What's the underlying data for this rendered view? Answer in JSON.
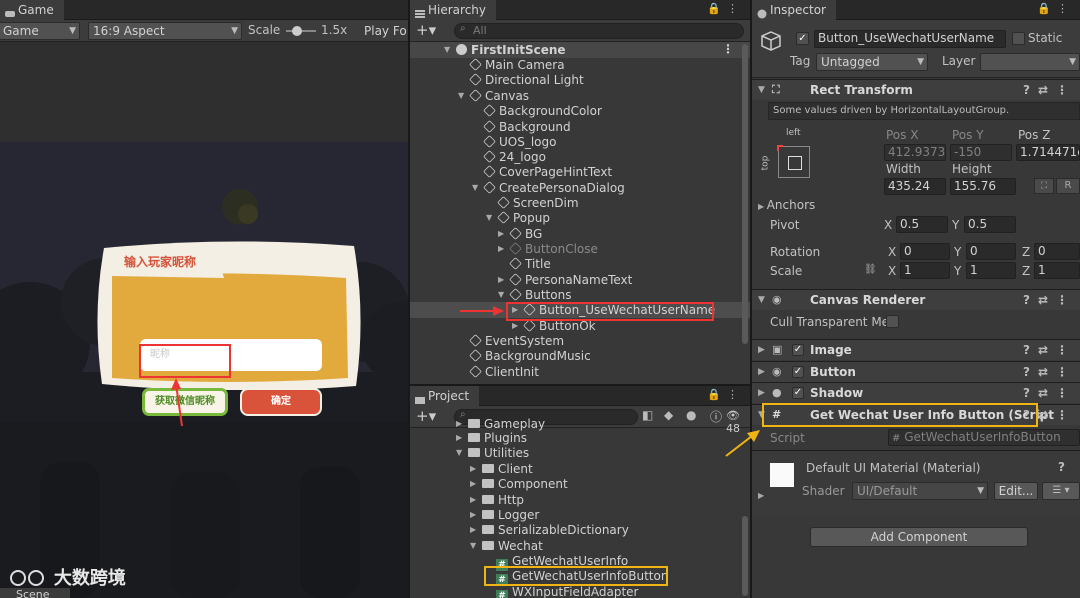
{
  "game": {
    "tab_label": "Game",
    "display_label": "Game",
    "aspect_label": "16:9 Aspect",
    "scale_label": "Scale",
    "scale_value": "1.5x",
    "play_label": "Play Fo",
    "dialog": {
      "title": "输入玩家昵称",
      "placeholder": "昵称",
      "wechat_button": "获取微信昵称",
      "confirm_button": "确定"
    },
    "scene_tab_label": "Scene",
    "watermark": "大数跨境"
  },
  "hierarchy": {
    "tab_label": "Hierarchy",
    "search_placeholder": "All",
    "scene_name": "FirstInitScene",
    "items": [
      {
        "label": "Main Camera"
      },
      {
        "label": "Directional Light"
      },
      {
        "label": "Canvas"
      },
      {
        "label": "BackgroundColor"
      },
      {
        "label": "Background"
      },
      {
        "label": "UOS_logo"
      },
      {
        "label": "24_logo"
      },
      {
        "label": "CoverPageHintText"
      },
      {
        "label": "CreatePersonaDialog"
      },
      {
        "label": "ScreenDim"
      },
      {
        "label": "Popup"
      },
      {
        "label": "BG"
      },
      {
        "label": "ButtonClose"
      },
      {
        "label": "Title"
      },
      {
        "label": "PersonaNameText"
      },
      {
        "label": "Buttons"
      },
      {
        "label": "Button_UseWechatUserName"
      },
      {
        "label": "ButtonOk"
      },
      {
        "label": "EventSystem"
      },
      {
        "label": "BackgroundMusic"
      },
      {
        "label": "ClientInit"
      }
    ]
  },
  "project": {
    "tab_label": "Project",
    "count_badge": "48",
    "items": [
      {
        "label": "Gameplay"
      },
      {
        "label": "Plugins"
      },
      {
        "label": "Utilities"
      },
      {
        "label": "Client"
      },
      {
        "label": "Component"
      },
      {
        "label": "Http"
      },
      {
        "label": "Logger"
      },
      {
        "label": "SerializableDictionary"
      },
      {
        "label": "Wechat"
      },
      {
        "label": "GetWechatUserInfo"
      },
      {
        "label": "GetWechatUserInfoButton"
      },
      {
        "label": "WXInputFieldAdapter"
      }
    ]
  },
  "inspector": {
    "tab_label": "Inspector",
    "object_name": "Button_UseWechatUserName",
    "static_label": "Static",
    "tag_label": "Tag",
    "tag_value": "Untagged",
    "layer_label": "Layer",
    "rect_transform": {
      "title": "Rect Transform",
      "note": "Some values driven by HorizontalLayoutGroup.",
      "anchor_h": "left",
      "anchor_v": "top",
      "pos_x_label": "Pos X",
      "pos_y_label": "Pos Y",
      "pos_z_label": "Pos Z",
      "pos_x": "412.9373",
      "pos_y": "-150",
      "pos_z": "1.714471e",
      "width_label": "Width",
      "height_label": "Height",
      "width": "435.24",
      "height": "155.76",
      "anchors_label": "Anchors",
      "pivot_label": "Pivot",
      "pivot_x": "0.5",
      "pivot_y": "0.5",
      "rotation_label": "Rotation",
      "rot_x": "0",
      "rot_y": "0",
      "rot_z": "0",
      "scale_label": "Scale",
      "scale_x": "1",
      "scale_y": "1",
      "scale_z": "1",
      "x_label": "X",
      "y_label": "Y",
      "z_label": "Z",
      "r_label": "R"
    },
    "canvas_renderer": {
      "title": "Canvas Renderer",
      "cull_label": "Cull Transparent Me"
    },
    "image_title": "Image",
    "button_title": "Button",
    "shadow_title": "Shadow",
    "script_component": {
      "title": "Get Wechat User Info Button (Script",
      "script_label": "Script",
      "script_value": "GetWechatUserInfoButton"
    },
    "material": {
      "title": "Default UI Material (Material)",
      "shader_label": "Shader",
      "shader_value": "UI/Default",
      "edit_label": "Edit..."
    },
    "add_component": "Add Component"
  },
  "colors": {
    "highlight_red": "#e33333",
    "highlight_yellow": "#f0b414",
    "dialog_gold": "#e2a93c",
    "wechat_green": "#7ab83c",
    "confirm_red": "#d9533b"
  }
}
